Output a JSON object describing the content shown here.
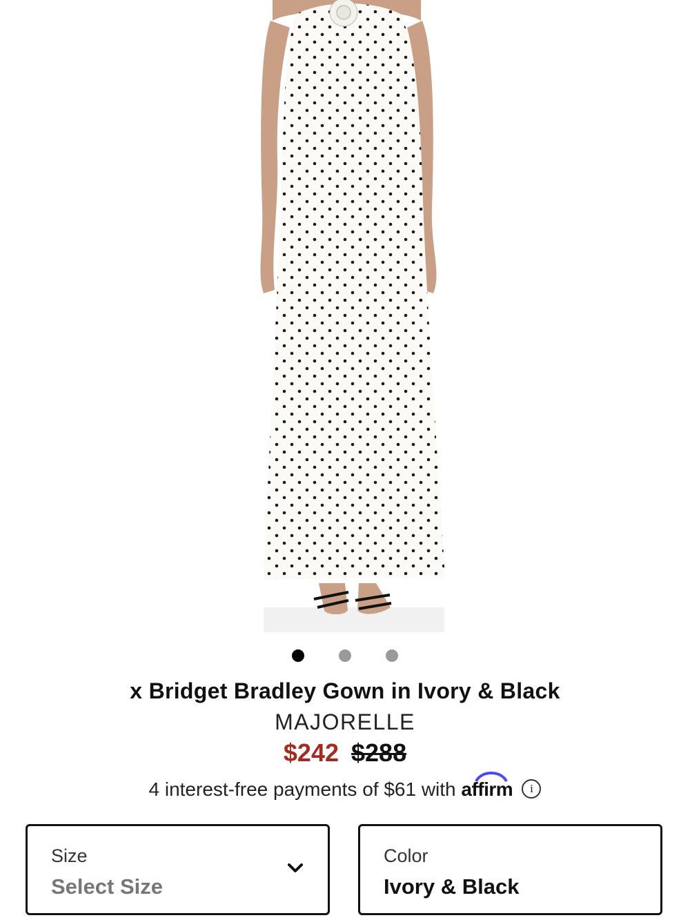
{
  "product": {
    "title": "x Bridget Bradley Gown in Ivory & Black",
    "brand": "MAJORELLE",
    "sale_price": "$242",
    "original_price": "$288",
    "colors": {
      "sale": "#a52a22",
      "text": "#111111"
    }
  },
  "gallery": {
    "image_count": 3,
    "active_index": 0
  },
  "financing": {
    "text": "4 interest-free payments of $61 with",
    "provider": "affirm",
    "info_icon": "info-icon"
  },
  "size_selector": {
    "label": "Size",
    "value": "Select Size",
    "icon": "chevron-down-icon"
  },
  "color_selector": {
    "label": "Color",
    "value": "Ivory & Black"
  }
}
